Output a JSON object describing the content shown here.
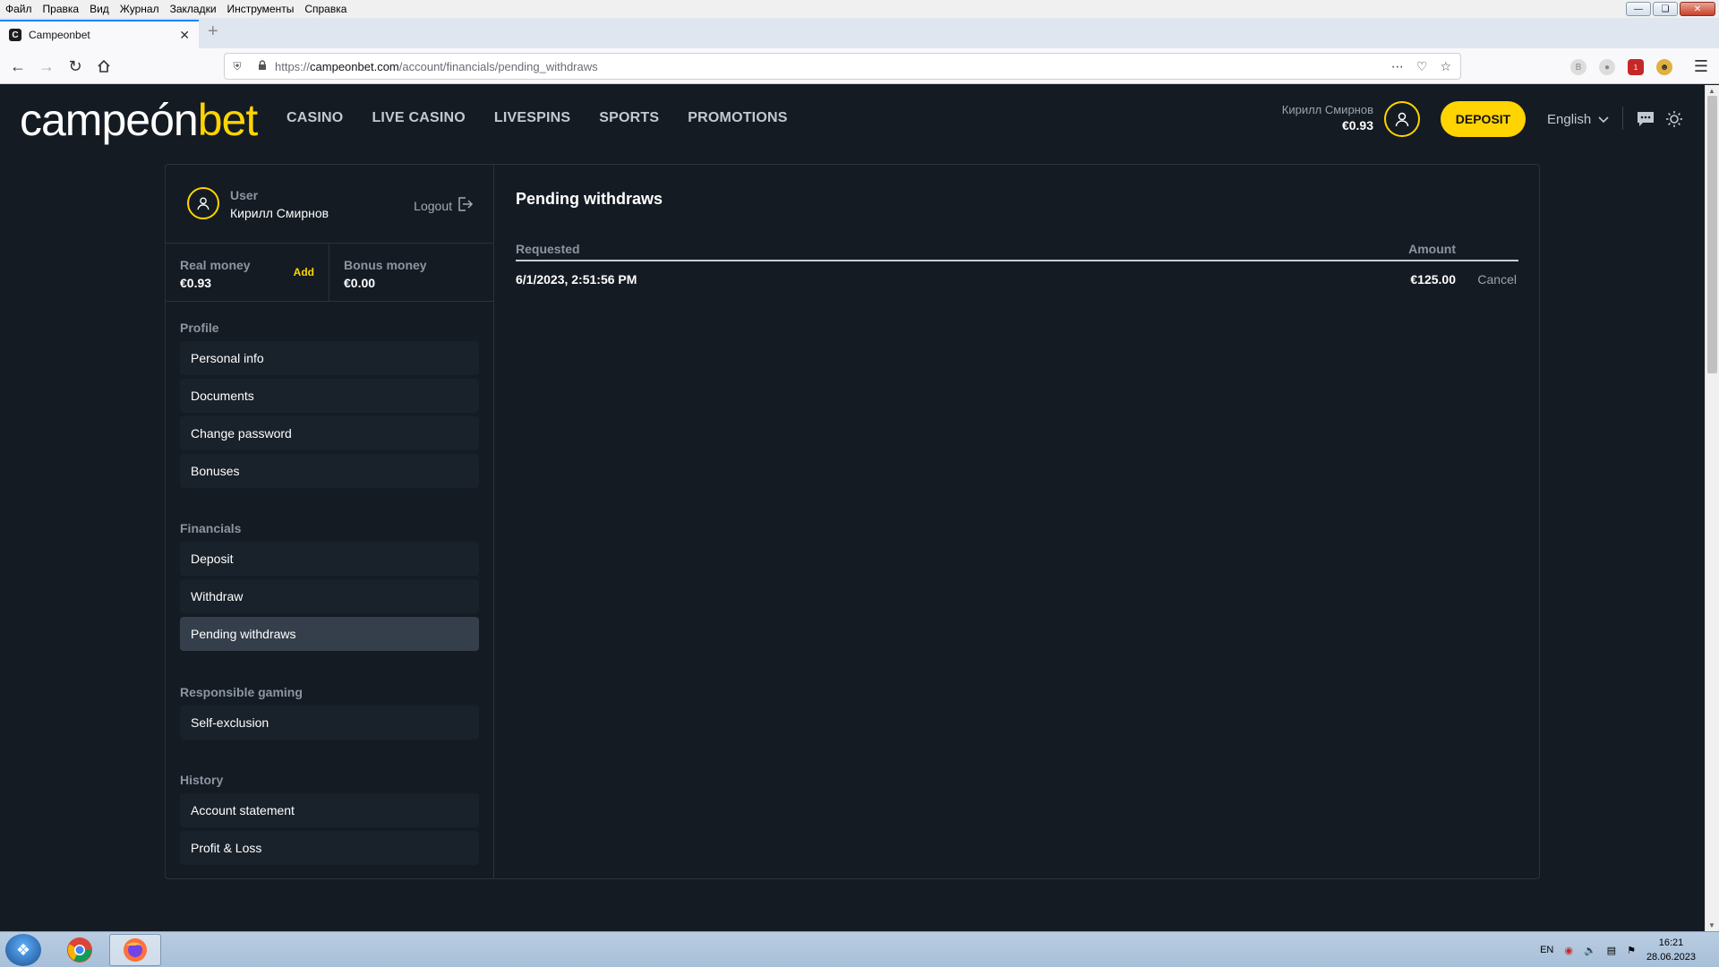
{
  "browser": {
    "menu": [
      "Файл",
      "Правка",
      "Вид",
      "Журнал",
      "Закладки",
      "Инструменты",
      "Справка"
    ],
    "tab_title": "Campeonbet",
    "url_scheme": "https://",
    "url_host": "campeonbet.com",
    "url_path": "/account/financials/pending_withdraws",
    "ext_badge": "1"
  },
  "header": {
    "logo_main": "campeón",
    "logo_accent": "bet",
    "nav": [
      "CASINO",
      "LIVE CASINO",
      "LIVESPINS",
      "SPORTS",
      "PROMOTIONS"
    ],
    "user_name": "Кирилл Смирнов",
    "user_balance": "€0.93",
    "deposit_label": "DEPOSIT",
    "language": "English"
  },
  "sidebar": {
    "role": "User",
    "name": "Кирилл Смирнов",
    "logout_label": "Logout",
    "real_money_label": "Real money",
    "real_money_value": "€0.93",
    "add_label": "Add",
    "bonus_money_label": "Bonus money",
    "bonus_money_value": "€0.00",
    "sections": [
      {
        "title": "Profile",
        "items": [
          "Personal info",
          "Documents",
          "Change password",
          "Bonuses"
        ]
      },
      {
        "title": "Financials",
        "items": [
          "Deposit",
          "Withdraw",
          "Pending withdraws"
        ]
      },
      {
        "title": "Responsible gaming",
        "items": [
          "Self-exclusion"
        ]
      },
      {
        "title": "History",
        "items": [
          "Account statement",
          "Profit & Loss"
        ]
      }
    ],
    "active_item": "Pending withdraws"
  },
  "content": {
    "title": "Pending withdraws",
    "columns": [
      "Requested",
      "Amount"
    ],
    "rows": [
      {
        "requested": "6/1/2023, 2:51:56 PM",
        "amount": "€125.00",
        "action": "Cancel"
      }
    ]
  },
  "taskbar": {
    "lang": "EN",
    "time": "16:21",
    "date": "28.06.2023"
  },
  "colors": {
    "accent": "#ffd400",
    "background": "#141b23",
    "menu_item_bg": "#19212a",
    "menu_item_active_bg": "#353f4b"
  }
}
